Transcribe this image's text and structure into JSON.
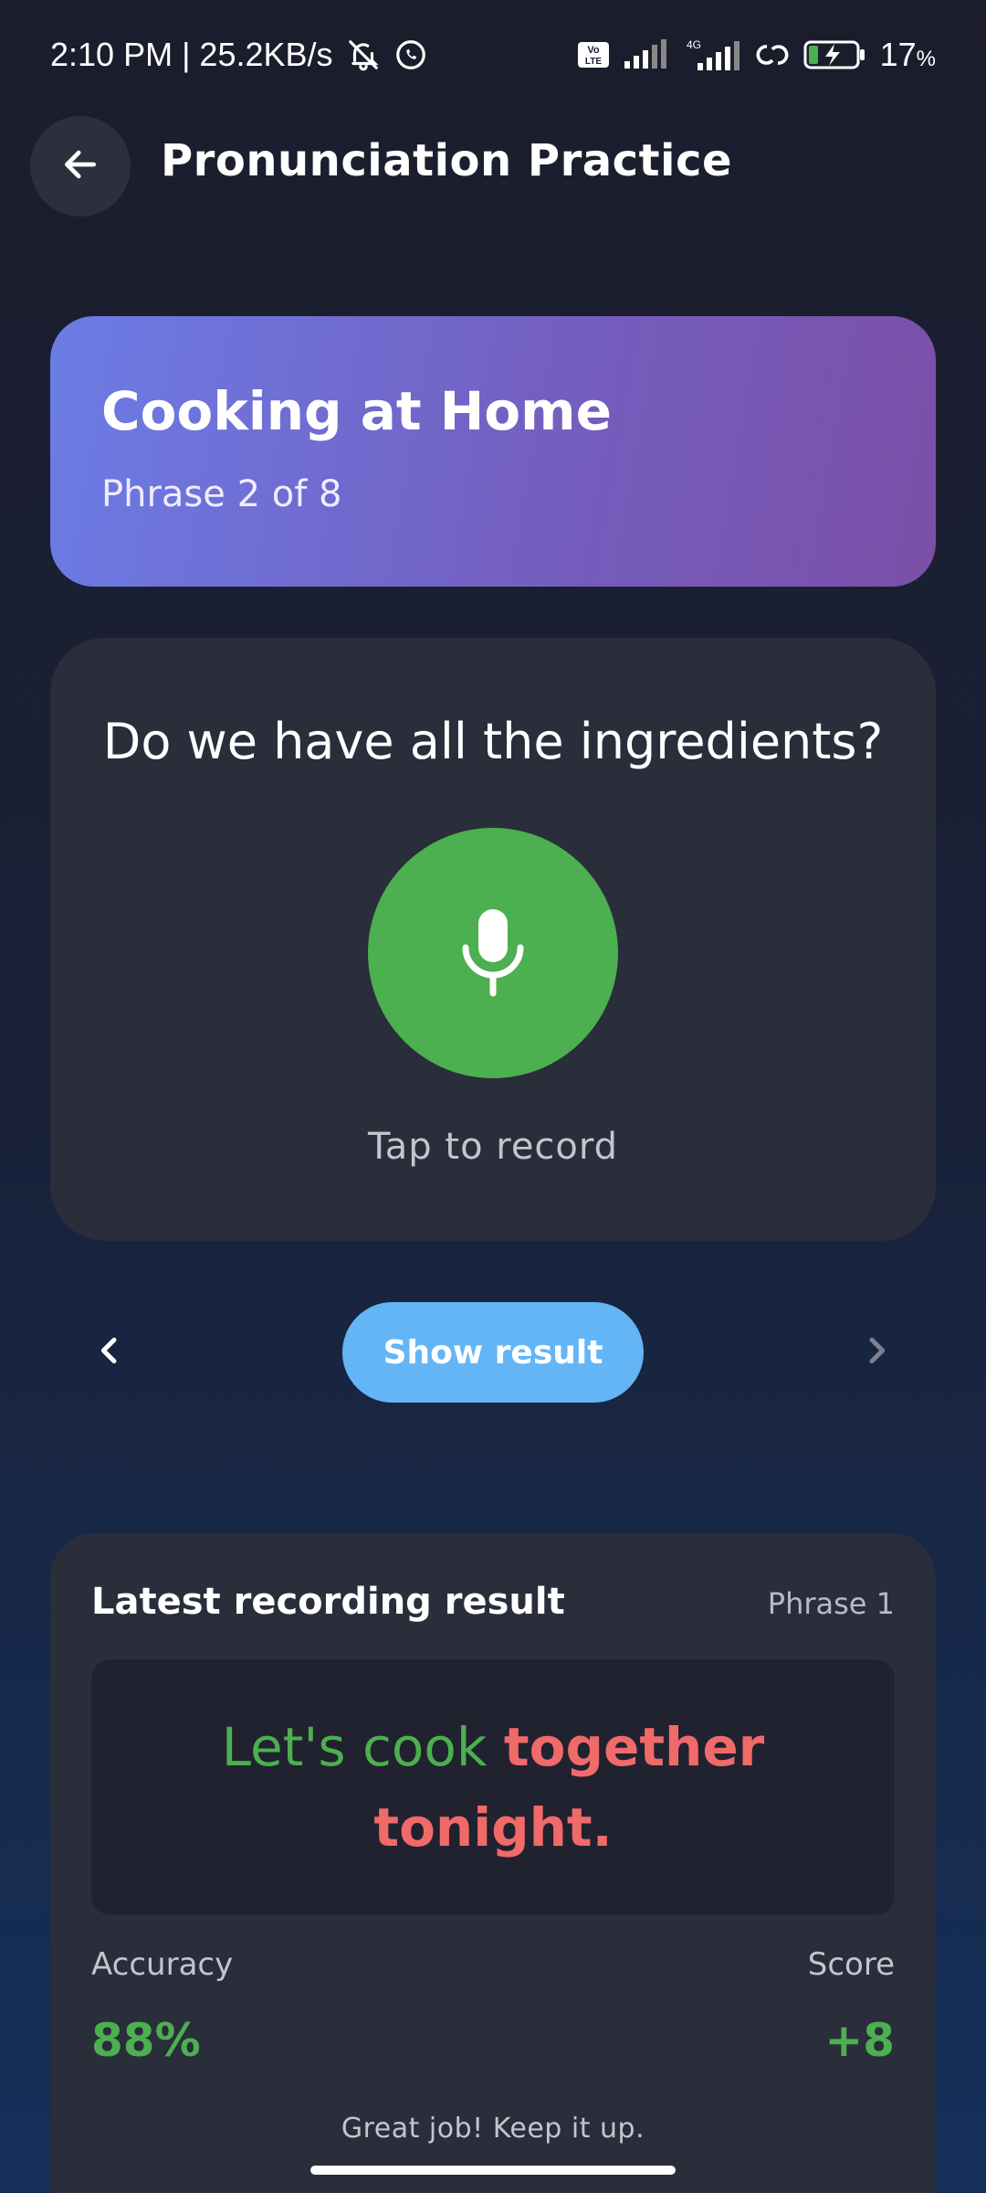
{
  "status_bar": {
    "time_speed": "2:10 PM | 25.2KB/s",
    "battery_percent": "17",
    "battery_unit": "%",
    "network_label": "4G",
    "volte_label": "Vo LTE"
  },
  "header": {
    "title": "Pronunciation Practice"
  },
  "topic": {
    "title": "Cooking at Home",
    "progress": "Phrase 2 of 8"
  },
  "phrase": {
    "text": "Do we have all the ingredients?",
    "record_hint": "Tap to record"
  },
  "nav": {
    "show_result_label": "Show result"
  },
  "result": {
    "title": "Latest recording result",
    "phrase_tag": "Phrase 1",
    "transcript": {
      "correct": "Let's cook ",
      "incorrect_1": "together",
      "incorrect_2": "tonight."
    },
    "accuracy_label": "Accuracy",
    "accuracy_value": "88%",
    "score_label": "Score",
    "score_value": "+8",
    "feedback": "Great job! Keep it up."
  },
  "colors": {
    "accent_green": "#4caf50",
    "accent_blue": "#64b5f6",
    "error_red": "#f06a6a"
  }
}
